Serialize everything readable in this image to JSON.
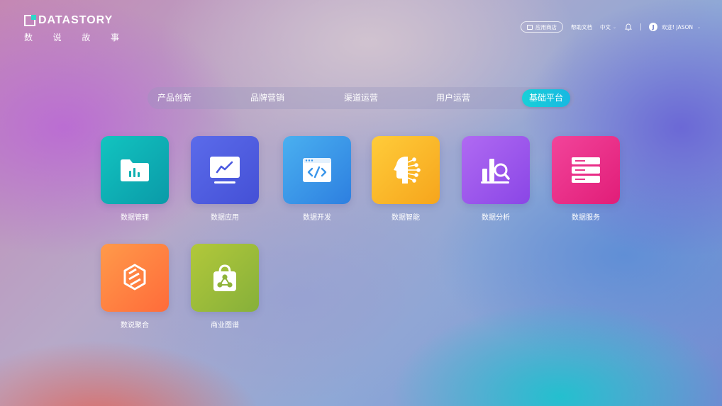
{
  "brand": {
    "logo_text": "DATASTORY",
    "subtitle": [
      "数",
      "说",
      "故",
      "事"
    ]
  },
  "topbar": {
    "app_store": "应用商店",
    "help_docs": "帮助文档",
    "language": "中文",
    "bell_icon": "bell-icon",
    "user_initial": "J",
    "welcome": "欢迎! JASON"
  },
  "tabs": [
    {
      "label": "产品创新",
      "active": false
    },
    {
      "label": "品牌营销",
      "active": false
    },
    {
      "label": "渠道运营",
      "active": false
    },
    {
      "label": "用户运营",
      "active": false
    },
    {
      "label": "基础平台",
      "active": true
    }
  ],
  "apps": [
    {
      "label": "数据管理",
      "icon": "folder-chart-icon",
      "gradient": [
        "#12c4c0",
        "#0a9aa8"
      ]
    },
    {
      "label": "数据应用",
      "icon": "monitor-chart-icon",
      "gradient": [
        "#5b6bea",
        "#4450d6"
      ]
    },
    {
      "label": "数据开发",
      "icon": "code-window-icon",
      "gradient": [
        "#4ab0f0",
        "#2d7fe0"
      ]
    },
    {
      "label": "数据智能",
      "icon": "ai-head-icon",
      "gradient": [
        "#ffcc3a",
        "#f6a51c"
      ]
    },
    {
      "label": "数据分析",
      "icon": "chart-search-icon",
      "gradient": [
        "#b06af2",
        "#8a46e6"
      ]
    },
    {
      "label": "数据服务",
      "icon": "server-icon",
      "gradient": [
        "#f2449a",
        "#e11d78"
      ]
    },
    {
      "label": "数说聚合",
      "icon": "cube-link-icon",
      "gradient": [
        "#ff9a4a",
        "#ff6b3a"
      ]
    },
    {
      "label": "商业图谱",
      "icon": "shopping-bag-graph-icon",
      "gradient": [
        "#b2c83a",
        "#86b03a"
      ]
    }
  ]
}
